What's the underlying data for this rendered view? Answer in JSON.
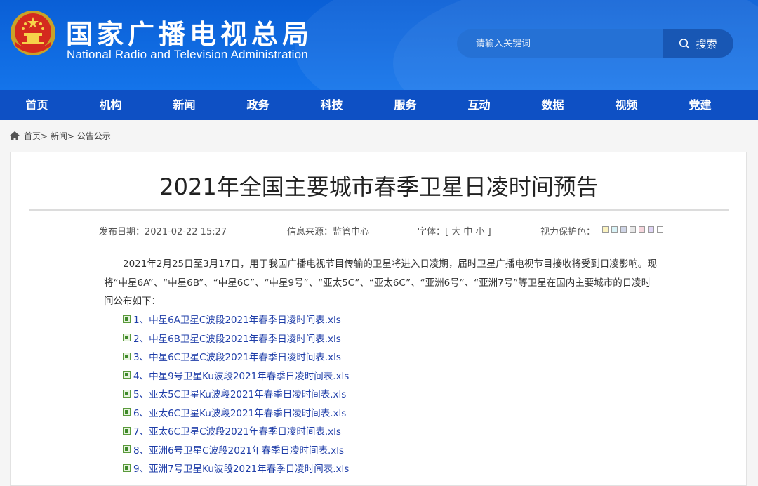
{
  "header": {
    "org_cn": "国家广播电视总局",
    "org_en": "National Radio and Television Administration",
    "search_placeholder": "请输入关键词",
    "search_button": "搜索",
    "emblem_icon": "national-emblem-icon",
    "search_icon": "search-icon"
  },
  "nav": [
    "首页",
    "机构",
    "新闻",
    "政务",
    "科技",
    "服务",
    "互动",
    "数据",
    "视频",
    "党建"
  ],
  "breadcrumb": [
    "首页>",
    "新闻>",
    "公告公示"
  ],
  "article": {
    "title": "2021年全国主要城市春季卫星日凌时间预告",
    "publish_date": "发布日期：2021-02-22 15:27",
    "source": "信息来源：监管中心",
    "font_size": "字体：[ 大 中 小 ]",
    "eye_care": "视力保护色：",
    "swatch_colors": [
      "#fbf3c0",
      "#d9f3f7",
      "#cfd5e7",
      "#e8e8e8",
      "#f6d5dc",
      "#e0d5f6",
      "#ffffff"
    ],
    "paragraph": "2021年2月25日至3月17日，用于我国广播电视节目传输的卫星将进入日凌期，届时卫星广播电视节目接收将受到日凌影响。现将“中星6A”、“中星6B”、“中星6C”、“中星9号”、“亚太5C”、“亚太6C”、“亚洲6号”、“亚洲7号”等卫星在国内主要城市的日凌时间公布如下：",
    "attachments": [
      "1、中星6A卫星C波段2021年春季日凌时间表.xls",
      "2、中星6B卫星C波段2021年春季日凌时间表.xls",
      "3、中星6C卫星C波段2021年春季日凌时间表.xls",
      "4、中星9号卫星Ku波段2021年春季日凌时间表.xls",
      "5、亚太5C卫星Ku波段2021年春季日凌时间表.xls",
      "6、亚太6C卫星Ku波段2021年春季日凌时间表.xls",
      "7、亚太6C卫星C波段2021年春季日凌时间表.xls",
      "8、亚洲6号卫星C波段2021年春季日凌时间表.xls",
      "9、亚洲7号卫星Ku波段2021年春季日凌时间表.xls"
    ]
  },
  "colors": {
    "header_blue": "#0a5fd6",
    "nav_blue": "#0e50c4",
    "link": "#1e3da8"
  }
}
